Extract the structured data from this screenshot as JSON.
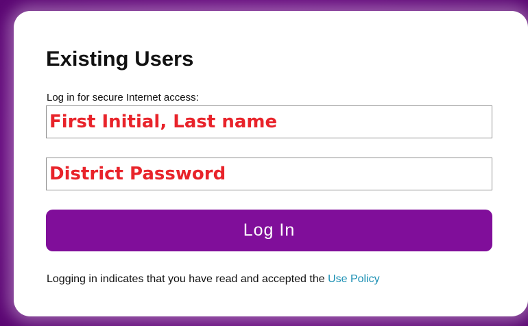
{
  "login": {
    "title": "Existing Users",
    "intro": "Log in for secure Internet access:",
    "username_overlay": "First Initial, Last name",
    "password_overlay": "District Password",
    "button_label": "Log In",
    "policy_text": "Logging in indicates that you have read and accepted the ",
    "policy_link": "Use Policy"
  },
  "colors": {
    "background": "#6a0a82",
    "button": "#800e9a",
    "annotation": "#e8232a",
    "link": "#1a8fb3"
  }
}
